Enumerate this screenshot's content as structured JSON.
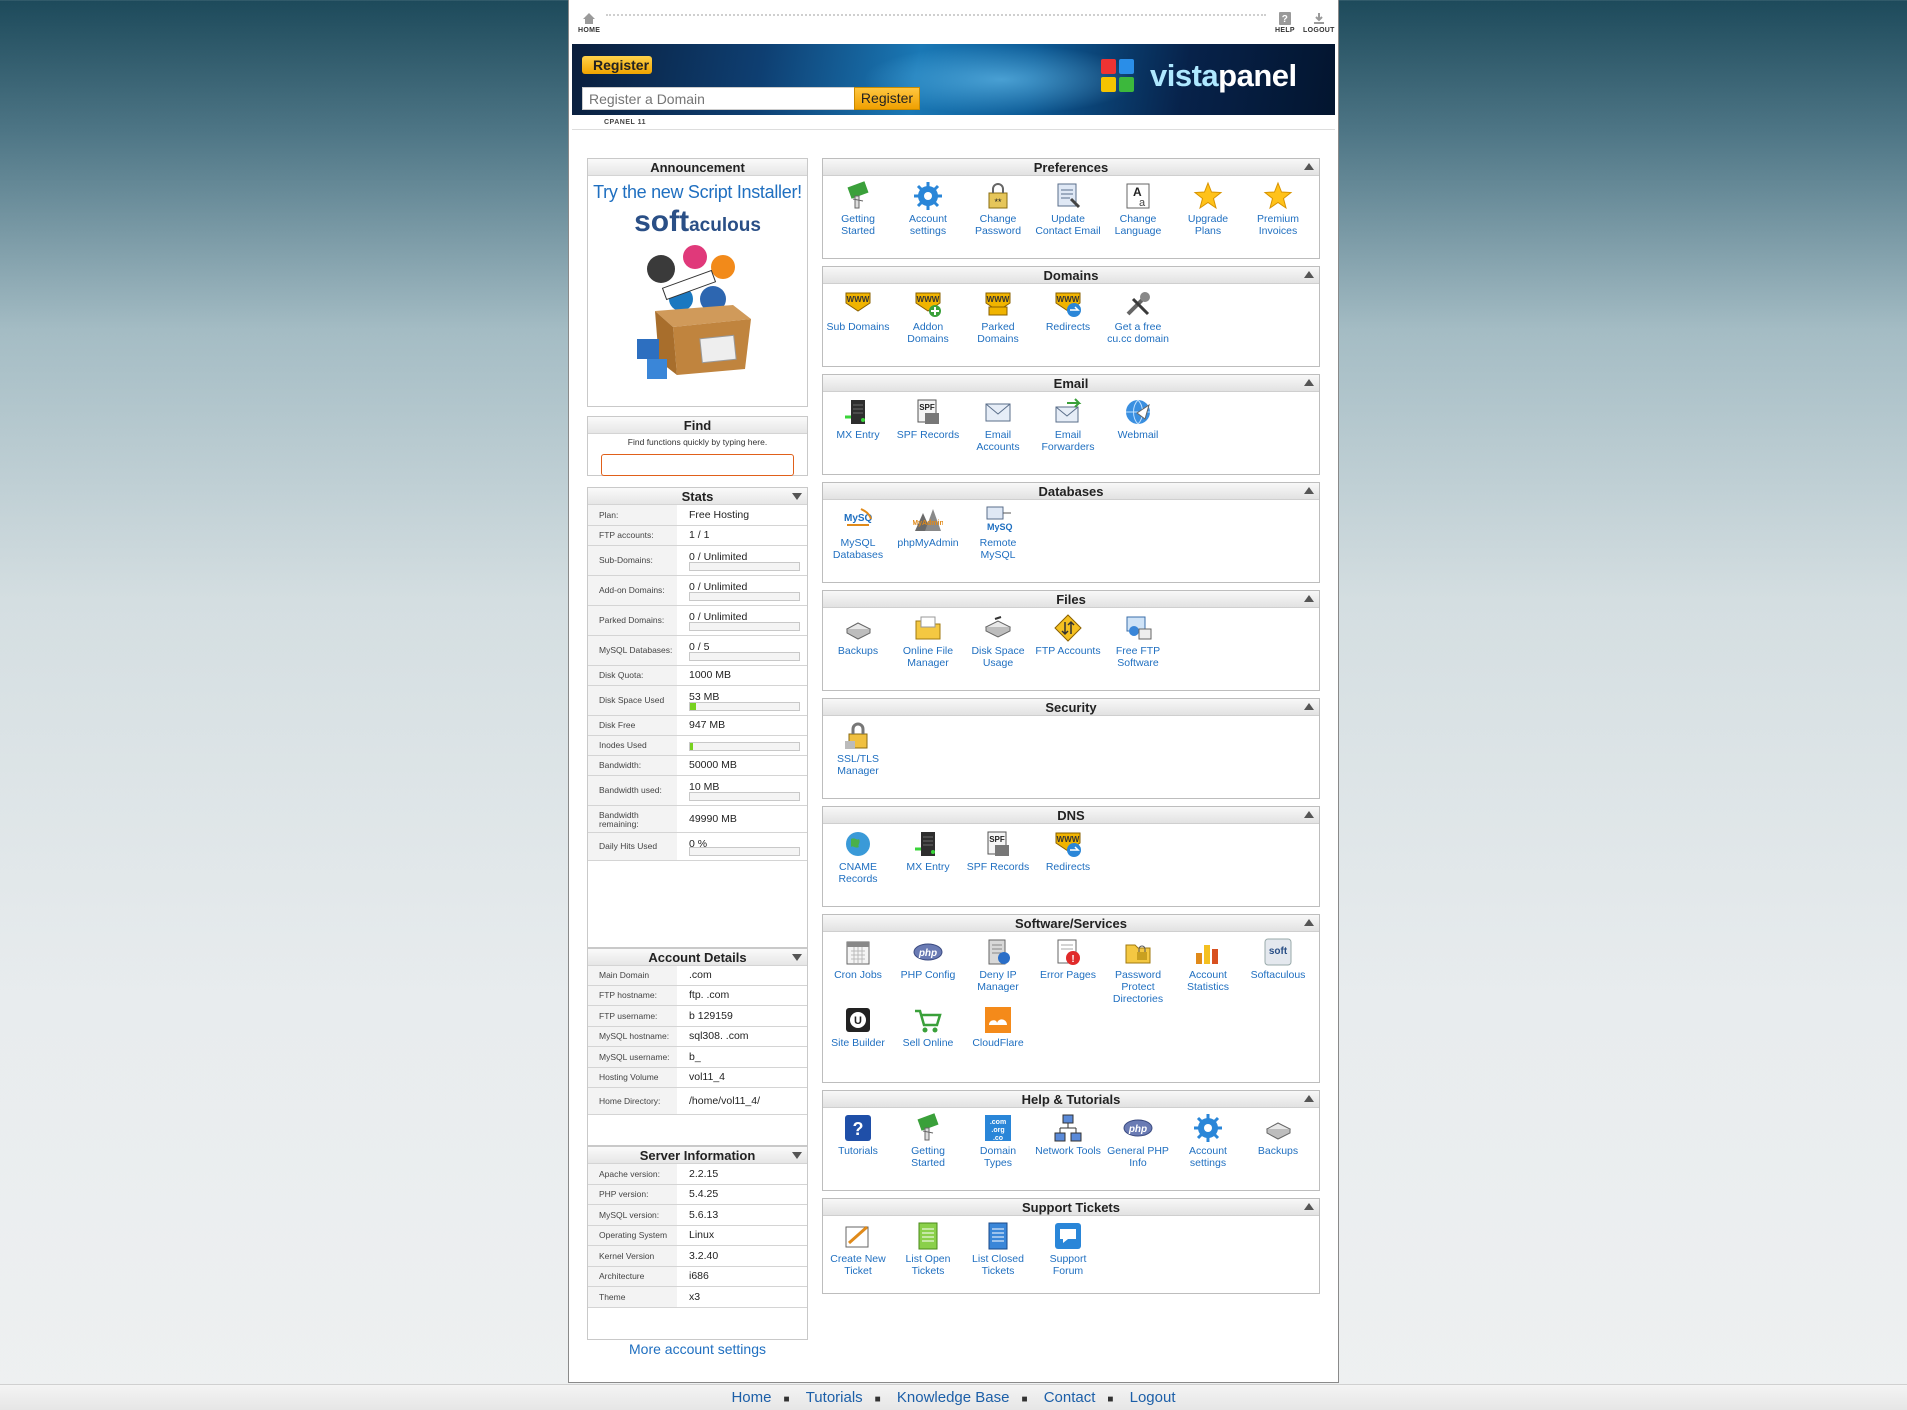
{
  "topbar": {
    "home": "HOME",
    "help": "HELP",
    "logout": "LOGOUT"
  },
  "banner": {
    "register_badge": "Register",
    "domain_placeholder": "Register a Domain",
    "register_button": "Register",
    "logo_left": "vista",
    "logo_right": "panel",
    "cpanel_label": "CPANEL 11"
  },
  "announcement": {
    "title": "Announcement",
    "headline": "Try the new Script Installer!",
    "brand_left": "soft",
    "brand_right": "aculous"
  },
  "find": {
    "title": "Find",
    "hint": "Find functions quickly by typing here.",
    "value": ""
  },
  "stats": {
    "title": "Stats",
    "rows": [
      {
        "label": "Plan:",
        "value": "Free Hosting"
      },
      {
        "label": "FTP accounts:",
        "value": "1 / 1"
      },
      {
        "label": "Sub-Domains:",
        "value": "0 / Unlimited",
        "progress": 0
      },
      {
        "label": "Add-on Domains:",
        "value": "0 / Unlimited",
        "progress": 0
      },
      {
        "label": "Parked Domains:",
        "value": "0 / Unlimited",
        "progress": 0
      },
      {
        "label": "MySQL Databases:",
        "value": "0 / 5",
        "progress": 0
      },
      {
        "label": "Disk Quota:",
        "value": "1000 MB"
      },
      {
        "label": "Disk Space Used",
        "value": "53 MB",
        "progress": 0.053
      },
      {
        "label": "Disk Free",
        "value": "947 MB"
      },
      {
        "label": "Inodes Used",
        "value": "",
        "progress": 0.02
      },
      {
        "label": "Bandwidth:",
        "value": "50000 MB"
      },
      {
        "label": "Bandwidth used:",
        "value": "10 MB",
        "progress": 0
      },
      {
        "label": "Bandwidth remaining:",
        "value": "49990 MB"
      },
      {
        "label": "Daily Hits Used",
        "value": "0 %",
        "progress": 0
      }
    ]
  },
  "account_details": {
    "title": "Account Details",
    "rows": [
      {
        "label": "Main Domain",
        "value": ".com"
      },
      {
        "label": "FTP hostname:",
        "value": "ftp.          .com"
      },
      {
        "label": "FTP username:",
        "value": "b       129159"
      },
      {
        "label": "MySQL hostname:",
        "value": "sql308.         .com"
      },
      {
        "label": "MySQL username:",
        "value": "b_       "
      },
      {
        "label": "Hosting Volume",
        "value": "vol11_4"
      },
      {
        "label": "Home Directory:",
        "value": "/home/vol11_4/"
      }
    ]
  },
  "server_info": {
    "title": "Server Information",
    "rows": [
      {
        "label": "Apache version:",
        "value": "2.2.15"
      },
      {
        "label": "PHP version:",
        "value": "5.4.25"
      },
      {
        "label": "MySQL version:",
        "value": "5.6.13"
      },
      {
        "label": "Operating System",
        "value": "Linux"
      },
      {
        "label": "Kernel Version",
        "value": "3.2.40"
      },
      {
        "label": "Architecture",
        "value": "i686"
      },
      {
        "label": "Theme",
        "value": "x3"
      }
    ]
  },
  "more_settings": "More account settings",
  "sections": [
    {
      "title": "Preferences",
      "items": [
        {
          "label": "Getting Started",
          "icon": "getting-started-icon"
        },
        {
          "label": "Account settings",
          "icon": "gear-icon"
        },
        {
          "label": "Change Password",
          "icon": "lock-icon"
        },
        {
          "label": "Update Contact Email",
          "icon": "contact-icon"
        },
        {
          "label": "Change Language",
          "icon": "language-icon"
        },
        {
          "label": "Upgrade Plans",
          "icon": "star-icon"
        },
        {
          "label": "Premium Invoices",
          "icon": "star-icon"
        }
      ]
    },
    {
      "title": "Domains",
      "items": [
        {
          "label": "Sub Domains",
          "icon": "www-icon"
        },
        {
          "label": "Addon Domains",
          "icon": "www-add-icon"
        },
        {
          "label": "Parked Domains",
          "icon": "www-stack-icon"
        },
        {
          "label": "Redirects",
          "icon": "www-redirect-icon"
        },
        {
          "label": "Get a free cu.cc domain",
          "icon": "tools-icon"
        }
      ]
    },
    {
      "title": "Email",
      "items": [
        {
          "label": "MX Entry",
          "icon": "server-icon"
        },
        {
          "label": "SPF Records",
          "icon": "spf-icon"
        },
        {
          "label": "Email Accounts",
          "icon": "envelope-icon"
        },
        {
          "label": "Email Forwarders",
          "icon": "forward-mail-icon"
        },
        {
          "label": "Webmail",
          "icon": "webmail-icon"
        }
      ]
    },
    {
      "title": "Databases",
      "items": [
        {
          "label": "MySQL Databases",
          "icon": "mysql-icon"
        },
        {
          "label": "phpMyAdmin",
          "icon": "phpmyadmin-icon"
        },
        {
          "label": "Remote MySQL",
          "icon": "remote-mysql-icon"
        }
      ]
    },
    {
      "title": "Files",
      "items": [
        {
          "label": "Backups",
          "icon": "disk-icon"
        },
        {
          "label": "Online File Manager",
          "icon": "folder-icon"
        },
        {
          "label": "Disk Space Usage",
          "icon": "disk-usage-icon"
        },
        {
          "label": "FTP Accounts",
          "icon": "ftp-icon"
        },
        {
          "label": "Free FTP Software",
          "icon": "ftp-software-icon"
        }
      ]
    },
    {
      "title": "Security",
      "items": [
        {
          "label": "SSL/TLS Manager",
          "icon": "ssl-lock-icon"
        }
      ]
    },
    {
      "title": "DNS",
      "items": [
        {
          "label": "CNAME Records",
          "icon": "globe-icon"
        },
        {
          "label": "MX Entry",
          "icon": "server-icon"
        },
        {
          "label": "SPF Records",
          "icon": "spf-icon"
        },
        {
          "label": "Redirects",
          "icon": "www-redirect-icon"
        }
      ]
    },
    {
      "title": "Software/Services",
      "items": [
        {
          "label": "Cron Jobs",
          "icon": "calendar-icon"
        },
        {
          "label": "PHP Config",
          "icon": "php-icon"
        },
        {
          "label": "Deny IP Manager",
          "icon": "deny-ip-icon"
        },
        {
          "label": "Error Pages",
          "icon": "error-page-icon"
        },
        {
          "label": "Password Protect Directories",
          "icon": "protected-folder-icon"
        },
        {
          "label": "Account Statistics",
          "icon": "stats-icon"
        },
        {
          "label": "Softaculous",
          "icon": "softaculous-icon"
        },
        {
          "label": "Site Builder",
          "icon": "site-builder-icon"
        },
        {
          "label": "Sell Online",
          "icon": "cart-icon"
        },
        {
          "label": "CloudFlare",
          "icon": "cloudflare-icon"
        }
      ]
    },
    {
      "title": "Help & Tutorials",
      "items": [
        {
          "label": "Tutorials",
          "icon": "question-icon"
        },
        {
          "label": "Getting Started",
          "icon": "getting-started-icon"
        },
        {
          "label": "Domain Types",
          "icon": "domain-types-icon"
        },
        {
          "label": "Network Tools",
          "icon": "network-icon"
        },
        {
          "label": "General PHP Info",
          "icon": "php-icon"
        },
        {
          "label": "Account settings",
          "icon": "gear-icon"
        },
        {
          "label": "Backups",
          "icon": "disk-icon"
        }
      ]
    },
    {
      "title": "Support Tickets",
      "items": [
        {
          "label": "Create New Ticket",
          "icon": "new-ticket-icon"
        },
        {
          "label": "List Open Tickets",
          "icon": "open-tickets-icon"
        },
        {
          "label": "List Closed Tickets",
          "icon": "closed-tickets-icon"
        },
        {
          "label": "Support Forum",
          "icon": "forum-icon"
        }
      ]
    }
  ],
  "footer": {
    "links": [
      "Home",
      "Tutorials",
      "Knowledge Base",
      "Contact",
      "Logout"
    ]
  },
  "colors": {
    "link": "#1f6fc0",
    "accent": "#f0a400",
    "progress": "#77d11f"
  }
}
